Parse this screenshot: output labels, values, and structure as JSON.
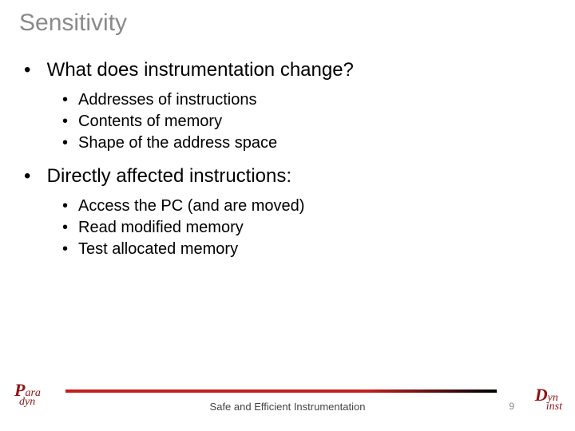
{
  "title": "Sensitivity",
  "bullets": {
    "b1": {
      "text": "What does instrumentation change?",
      "sub": {
        "s1": "Addresses of instructions",
        "s2": "Contents of memory",
        "s3": "Shape of the address space"
      }
    },
    "b2": {
      "text": "Directly affected instructions:",
      "sub": {
        "s1": "Access the PC (and are moved)",
        "s2": "Read modified memory",
        "s3": "Test allocated memory"
      }
    }
  },
  "footer": {
    "title": "Safe and Efficient Instrumentation",
    "page_number": "9",
    "logo_left": {
      "top": "P",
      "top_suffix": "ara",
      "bottom": "dyn"
    },
    "logo_right": {
      "top": "D",
      "top_suffix": "yn",
      "bottom": "inst"
    }
  }
}
